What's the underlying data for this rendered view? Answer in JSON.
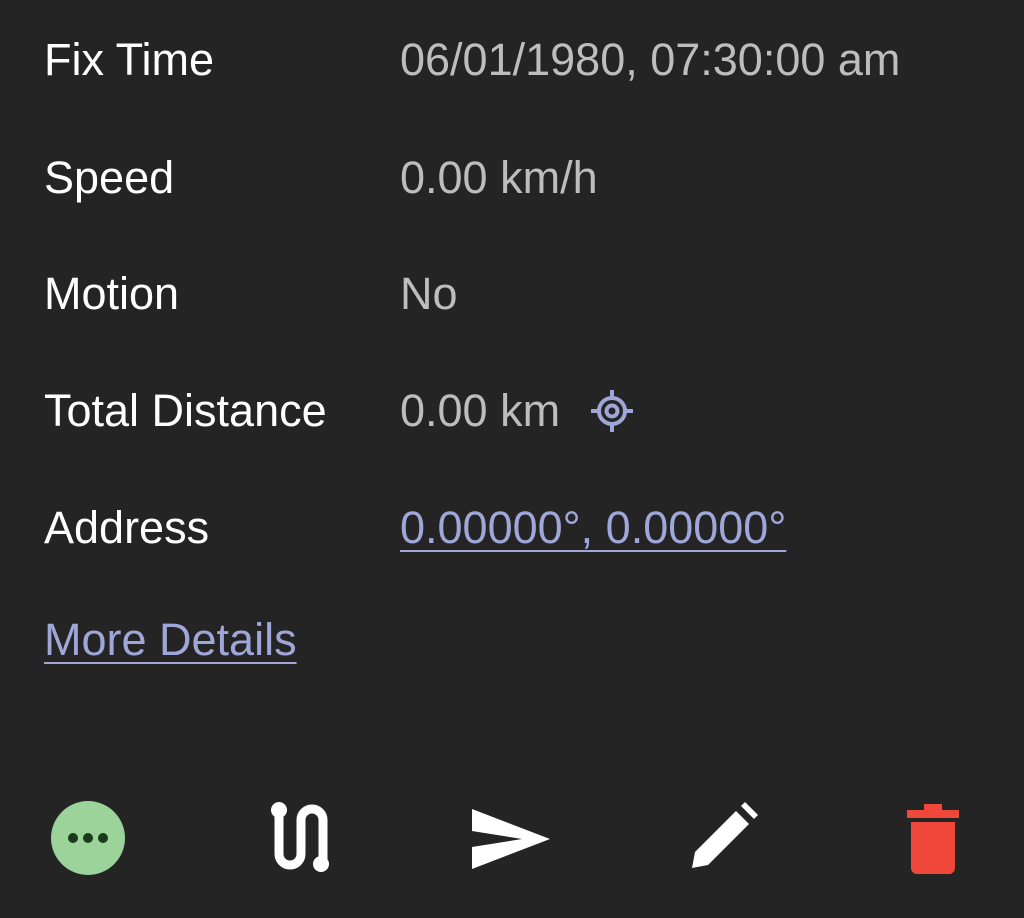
{
  "rows": [
    {
      "label": "Fix Time",
      "value": "06/01/1980, 07:30:00 am"
    },
    {
      "label": "Speed",
      "value": "0.00 km/h"
    },
    {
      "label": "Motion",
      "value": "No"
    },
    {
      "label": "Total Distance",
      "value": "0.00 km"
    },
    {
      "label": "Address",
      "value": "0.00000°, 0.00000°"
    }
  ],
  "more_details_label": "More Details",
  "icons": {
    "distance_settings": "gear-icon",
    "more": "more-horizontal-icon",
    "route": "route-icon",
    "send": "send-icon",
    "edit": "pencil-icon",
    "delete": "trash-icon"
  },
  "colors": {
    "background": "#242424",
    "label": "#ffffff",
    "value": "#bdbdbd",
    "link": "#9fa6d8",
    "more_button": "#9bd39a",
    "delete": "#f0473b"
  }
}
